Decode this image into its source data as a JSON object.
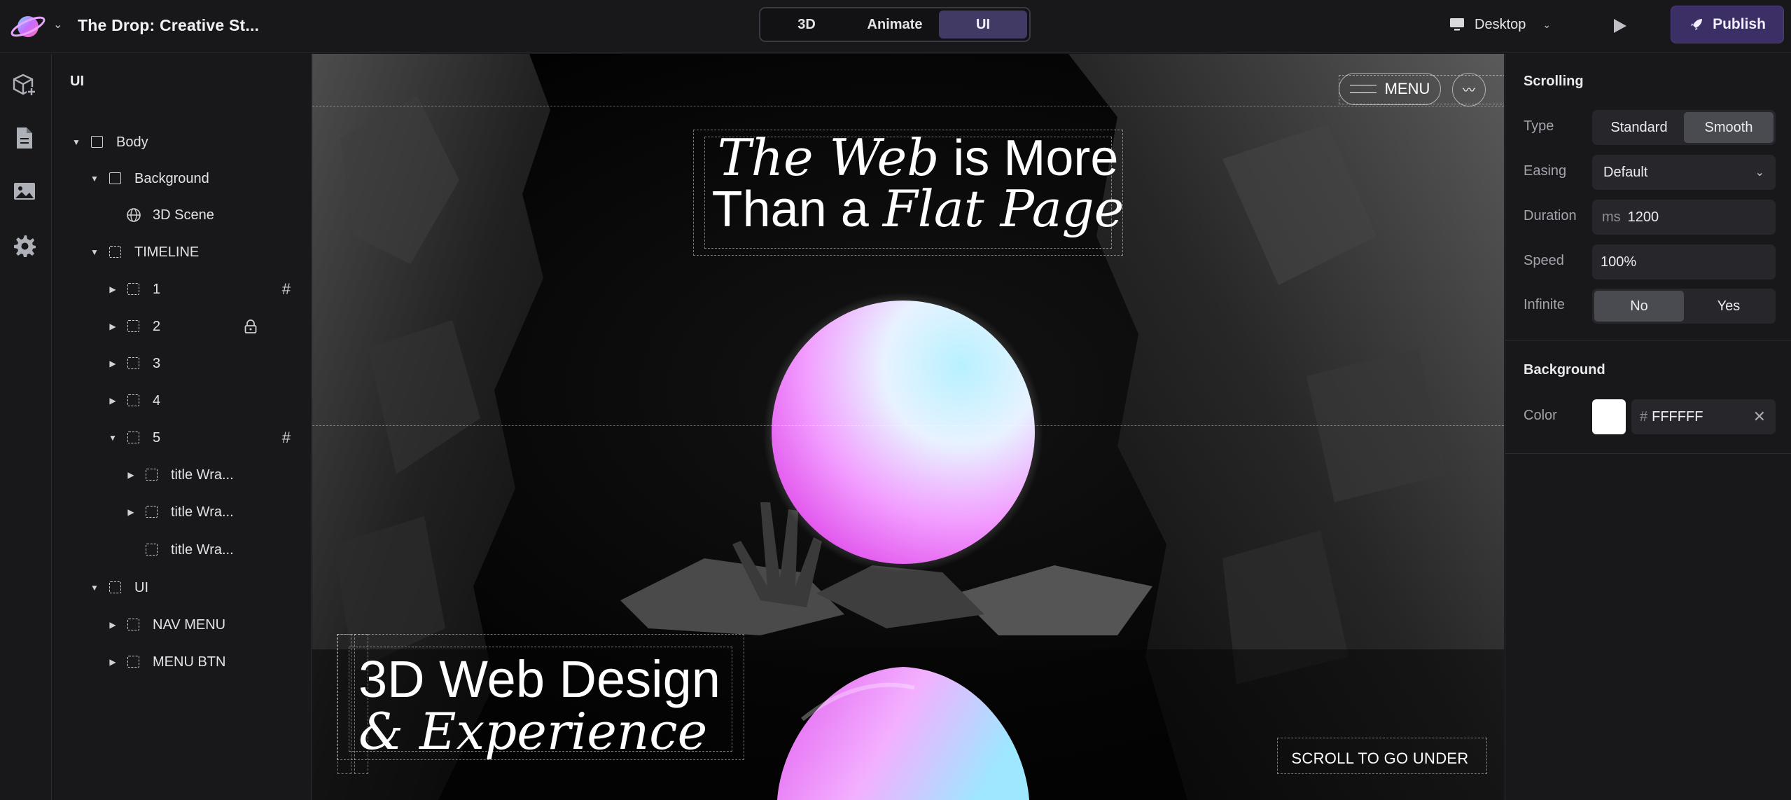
{
  "app": {
    "project_title": "The Drop: Creative St...",
    "modes": [
      "3D",
      "Animate",
      "UI"
    ],
    "active_mode": "UI",
    "device": "Desktop",
    "publish_label": "Publish",
    "accent_color": "#413a64"
  },
  "rail": {
    "icons": [
      "add-object-icon",
      "page-icon",
      "image-icon",
      "gear-icon"
    ]
  },
  "layers": {
    "title": "UI",
    "items": [
      {
        "label": "Body",
        "icon": "box-solid"
      },
      {
        "label": "Background",
        "icon": "box-solid"
      },
      {
        "label": "3D Scene",
        "icon": "globe"
      },
      {
        "label": "TIMELINE",
        "icon": "box-dashed"
      },
      {
        "label": "1",
        "icon": "box-dashed",
        "badge": "#"
      },
      {
        "label": "2",
        "icon": "box-dashed",
        "locked": true
      },
      {
        "label": "3",
        "icon": "box-dashed"
      },
      {
        "label": "4",
        "icon": "box-dashed"
      },
      {
        "label": "5",
        "icon": "box-dashed",
        "badge": "#"
      },
      {
        "label": "title Wra...",
        "icon": "box-dashed"
      },
      {
        "label": "title Wra...",
        "icon": "box-dashed"
      },
      {
        "label": "title Wra...",
        "icon": "box-dashed"
      },
      {
        "label": "UI",
        "icon": "box-dashed"
      },
      {
        "label": "NAV MENU",
        "icon": "box-dashed"
      },
      {
        "label": "MENU BTN",
        "icon": "box-dashed"
      }
    ]
  },
  "canvas": {
    "hero": {
      "line1_italic": "The Web",
      "line1_rest": " is More",
      "line2_start": "Than a ",
      "line2_italic": "Flat Page"
    },
    "subtitle": {
      "line1": "3D Web Design",
      "line2": "& Experience"
    },
    "menu_label": "MENU",
    "wave_icon": "〰",
    "scroll_hint": "SCROLL TO GO UNDER"
  },
  "props": {
    "scrolling": {
      "title": "Scrolling",
      "type_label": "Type",
      "type_options": [
        "Standard",
        "Smooth"
      ],
      "type_selected": "Smooth",
      "easing_label": "Easing",
      "easing_value": "Default",
      "duration_label": "Duration",
      "duration_unit": "ms",
      "duration_value": "1200",
      "speed_label": "Speed",
      "speed_value": "100%",
      "infinite_label": "Infinite",
      "infinite_options": [
        "No",
        "Yes"
      ],
      "infinite_selected": "No"
    },
    "background": {
      "title": "Background",
      "color_label": "Color",
      "color_prefix": "#",
      "color_value": "FFFFFF"
    }
  }
}
